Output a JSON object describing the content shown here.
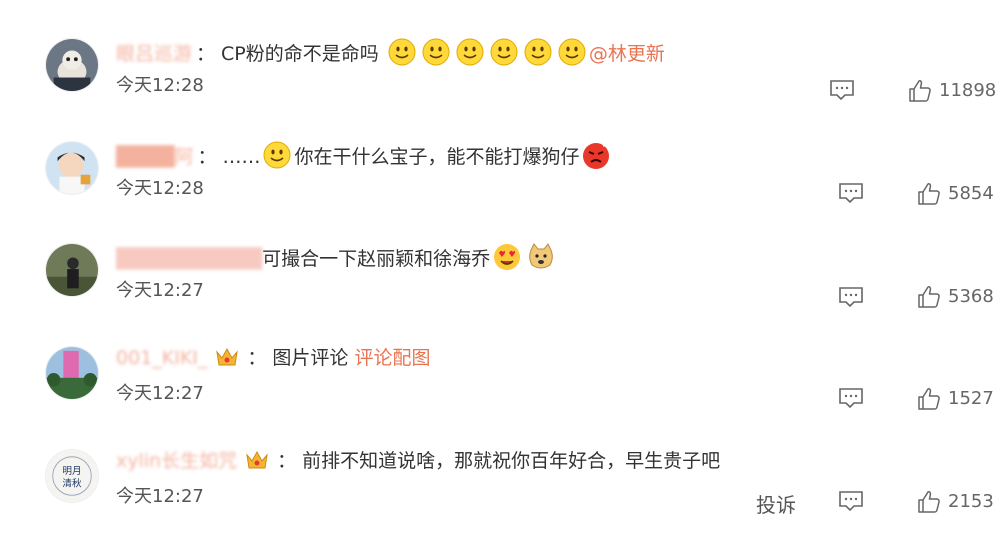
{
  "comments": [
    {
      "username": "眼吕巡游",
      "colon": "：",
      "text": "CP粉的命不是命吗",
      "emojis": [
        "smile-emoji",
        "smile-emoji",
        "smile-emoji",
        "smile-emoji",
        "smile-emoji",
        "smile-emoji"
      ],
      "mention": "@林更新",
      "time": "今天12:28",
      "likes": "11898"
    },
    {
      "username": "████阿",
      "colon": "：",
      "text_before": "……",
      "text_after": "你在干什么宝子，能不能打爆狗仔",
      "time": "今天12:28",
      "likes": "5854"
    },
    {
      "username": "██████████",
      "text": "可撮合一下赵丽颖和徐海乔",
      "time": "今天12:27",
      "likes": "5368"
    },
    {
      "username": "001_KIKI_",
      "colon": "：",
      "text": "图片评论",
      "pic_link": "评论配图",
      "time": "今天12:27",
      "likes": "1527"
    },
    {
      "username": "xylin长生如咒",
      "colon": "：",
      "text": "前排不知道说啥，那就祝你百年好合，早生贵子吧",
      "time": "今天12:27",
      "likes": "2153",
      "report": "投诉"
    }
  ],
  "colors": {
    "accent": "#eb7350",
    "text": "#333333",
    "muted": "#666666"
  }
}
